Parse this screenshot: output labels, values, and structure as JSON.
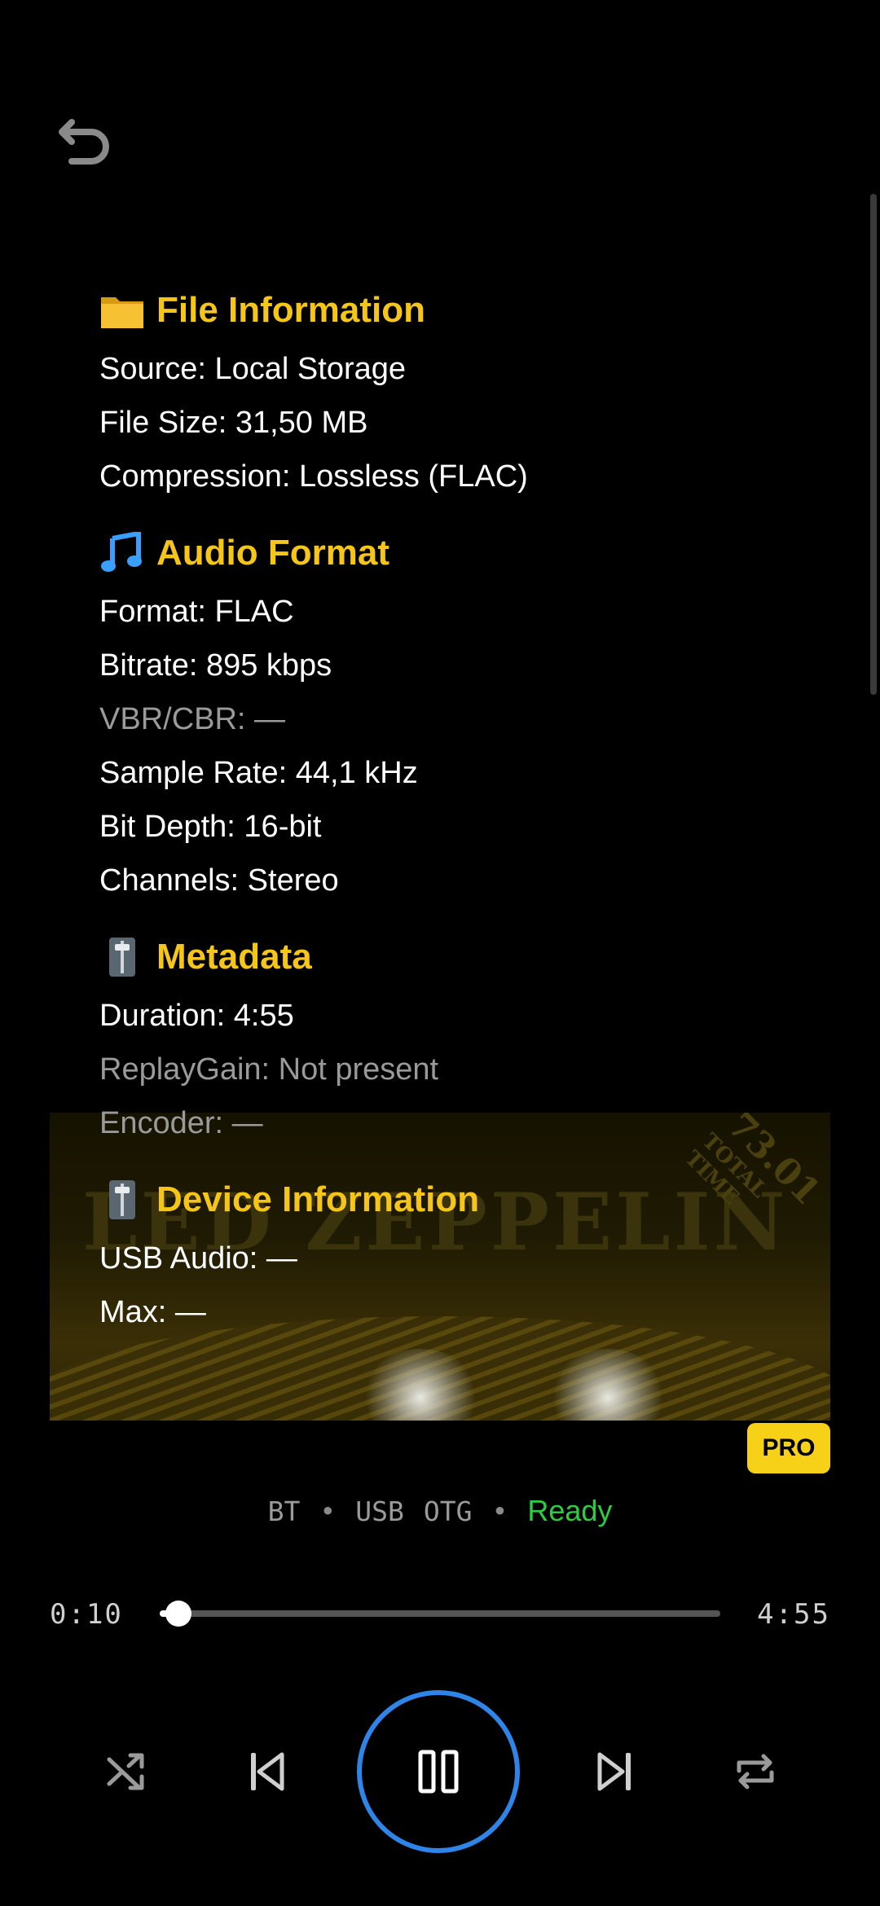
{
  "colors": {
    "background": "#000000",
    "accent": "#f5c518",
    "ready": "#2ecc40",
    "play_ring": "#2f84e8",
    "pro_badge": "#f7d117"
  },
  "icons": {
    "back": "undo-arrow-icon",
    "folder": "folder-icon",
    "music": "music-note-icon",
    "slider": "level-slider-icon",
    "shuffle": "shuffle-icon",
    "previous": "skip-previous-icon",
    "pause": "pause-icon",
    "next": "skip-next-icon",
    "repeat": "repeat-icon"
  },
  "album_art": {
    "band": "LED ZEPPELIN",
    "total_time_value": "73.01",
    "total_time_label": "TOTAL TIME"
  },
  "sections": {
    "file": {
      "title": "File Information",
      "rows": [
        "Source: Local Storage",
        "File Size: 31,50 MB",
        "Compression: Lossless (FLAC)"
      ]
    },
    "audio": {
      "title": "Audio Format",
      "rows": [
        "Format: FLAC",
        "Bitrate: 895 kbps",
        "VBR/CBR: —",
        "Sample Rate: 44,1 kHz",
        "Bit Depth: 16-bit",
        "Channels: Stereo"
      ]
    },
    "metadata": {
      "title": "Metadata",
      "rows": [
        "Duration: 4:55",
        "ReplayGain: Not present",
        "Encoder: —"
      ]
    },
    "device": {
      "title": "Device Information",
      "rows": [
        "USB Audio: —",
        "Max: —"
      ]
    }
  },
  "badge": "PRO",
  "status": {
    "bt": "BT",
    "sep": "•",
    "usb": "USB",
    "otg": "OTG",
    "ready": "Ready"
  },
  "player": {
    "current_time": "0:10",
    "total_time": "4:55",
    "progress": 0.034
  }
}
